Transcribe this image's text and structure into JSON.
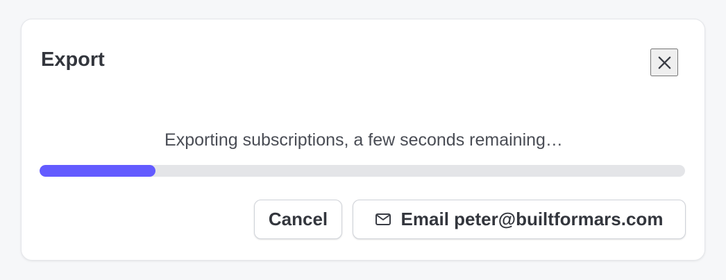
{
  "dialog": {
    "title": "Export",
    "close_icon": "close-icon",
    "status_text": "Exporting subscriptions, a few seconds remaining…",
    "progress": {
      "value_percent": 18,
      "fill_color": "#635bff",
      "track_color": "#e4e5e8"
    },
    "buttons": {
      "cancel_label": "Cancel",
      "email_label": "Email peter@builtformars.com",
      "email_icon": "mail-icon"
    }
  }
}
